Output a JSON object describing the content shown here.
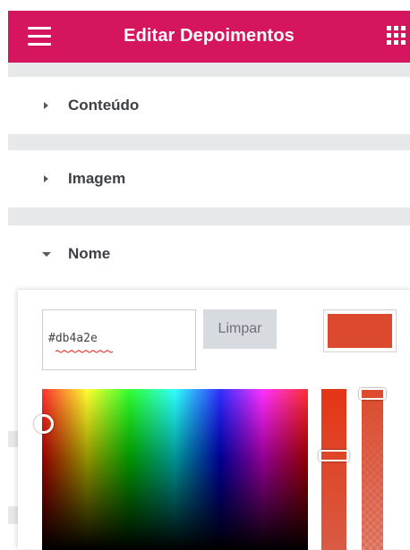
{
  "header": {
    "title": "Editar Depoimentos",
    "background": "#d5155d",
    "menu_icon": "hamburger-icon",
    "apps_icon": "grid-icon"
  },
  "sections": [
    {
      "label": "Conteúdo",
      "expanded": false,
      "icon": "caret-right-icon"
    },
    {
      "label": "Imagem",
      "expanded": false,
      "icon": "caret-right-icon"
    },
    {
      "label": "Nome",
      "expanded": true,
      "icon": "caret-down-icon"
    }
  ],
  "color_picker": {
    "hex_value": "#db4a2e",
    "clear_label": "Limpar",
    "selected_color": "#db4a2e",
    "spellcheck_underline_color": "#e53935"
  }
}
